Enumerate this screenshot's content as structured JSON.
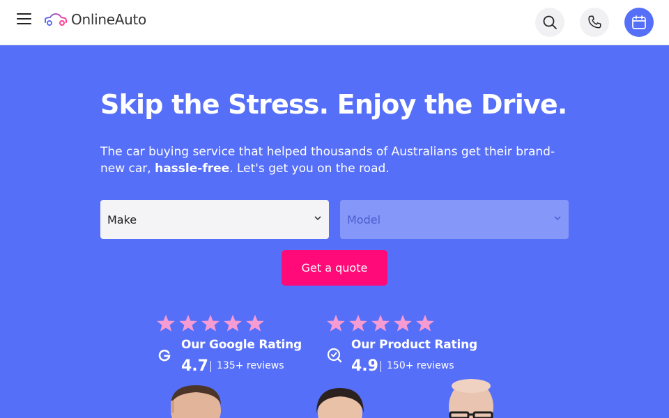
{
  "header": {
    "logo_text": "OnlineAuto",
    "menu_icon": "hamburger-icon",
    "actions": [
      {
        "name": "search",
        "icon": "search-icon"
      },
      {
        "name": "phone",
        "icon": "phone-icon"
      },
      {
        "name": "calendar",
        "icon": "calendar-icon"
      }
    ]
  },
  "hero": {
    "title": "Skip the Stress. Enjoy the Drive.",
    "subtitle_before": "The car buying service that helped thousands of Australians get their brand-new car, ",
    "subtitle_bold": "hassle-free",
    "subtitle_after": ". Let's get you on the road."
  },
  "form": {
    "make_value": "Make",
    "model_value": "Model",
    "quote_button": "Get a quote"
  },
  "ratings": [
    {
      "title": "Our Google Rating",
      "score": "4.7",
      "reviews": "135+ reviews",
      "stars": 5,
      "icon": "google-icon"
    },
    {
      "title": "Our Product Rating",
      "score": "4.9",
      "reviews": "150+ reviews",
      "stars": 5,
      "icon": "product-review-icon"
    }
  ],
  "colors": {
    "brand": "#566ff8",
    "cta": "#ff0a78",
    "star": "#f79bd3"
  }
}
